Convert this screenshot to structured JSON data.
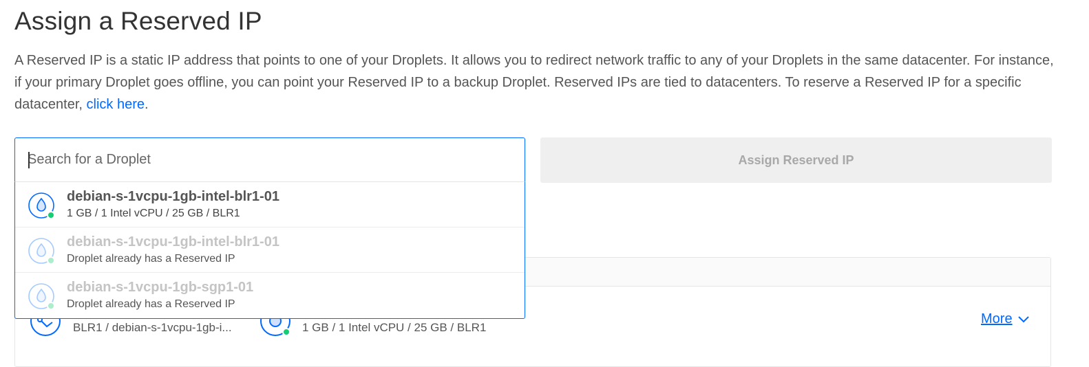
{
  "header": {
    "title": "Assign a Reserved IP"
  },
  "description": {
    "text_before_link": "A Reserved IP is a static IP address that points to one of your Droplets. It allows you to redirect network traffic to any of your Droplets in the same datacenter. For instance, if your primary Droplet goes offline, you can point your Reserved IP to a backup Droplet. Reserved IPs are tied to datacenters. To reserve a Reserved IP for a specific datacenter, ",
    "link_text": "click here",
    "text_after_link": "."
  },
  "search": {
    "placeholder": "Search for a Droplet",
    "value": ""
  },
  "assign_button": {
    "label": "Assign Reserved IP"
  },
  "dropdown": {
    "options": [
      {
        "name": "debian-s-1vcpu-1gb-intel-blr1-01",
        "subtitle": "1 GB / 1 Intel vCPU / 25 GB / BLR1",
        "disabled": false,
        "icon": "droplet-icon"
      },
      {
        "name": "debian-s-1vcpu-1gb-intel-blr1-01",
        "subtitle": "Droplet already has a Reserved IP",
        "disabled": true,
        "icon": "droplet-icon"
      },
      {
        "name": "debian-s-1vcpu-1gb-sgp1-01",
        "subtitle": "Droplet already has a Reserved IP",
        "disabled": true,
        "icon": "droplet-icon"
      }
    ]
  },
  "background_table": {
    "row": {
      "location_text": "BLR1 / debian-s-1vcpu-1gb-i...",
      "specs_text": "1 GB / 1 Intel vCPU / 25 GB / BLR1",
      "more_label": "More"
    }
  },
  "colors": {
    "accent": "#0069ff",
    "status_online": "#15cd72"
  }
}
